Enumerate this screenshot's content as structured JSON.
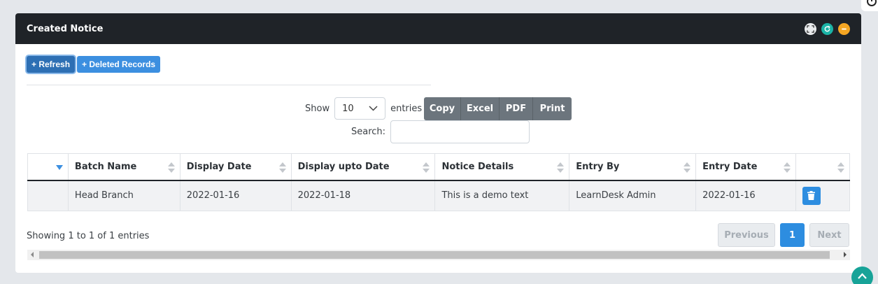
{
  "panel": {
    "title": "Created Notice",
    "tools": [
      "fullscreen-icon",
      "reload-icon",
      "minimize-icon"
    ]
  },
  "actions": {
    "refresh_label": "+ Refresh",
    "deleted_label": "+ Deleted Records"
  },
  "length": {
    "show_label": "Show",
    "value": "10",
    "entries_label": "entries"
  },
  "export": {
    "copy": "Copy",
    "excel": "Excel",
    "pdf": "PDF",
    "print": "Print"
  },
  "search": {
    "label": "Search:",
    "value": ""
  },
  "table": {
    "columns": [
      "",
      "Batch Name",
      "Display Date",
      "Display upto Date",
      "Notice Details",
      "Entry By",
      "Entry Date",
      ""
    ],
    "rows": [
      {
        "batch_name": "Head Branch",
        "display_date": "2022-01-16",
        "display_upto_date": "2022-01-18",
        "notice_details": "This is a demo text",
        "entry_by": "LearnDesk Admin",
        "entry_date": "2022-01-16",
        "action_icon": "trash-icon"
      }
    ]
  },
  "footer": {
    "info": "Showing 1 to 1 of 1 entries",
    "previous": "Previous",
    "current_page": "1",
    "next": "Next"
  },
  "colors": {
    "header_bg": "#1f2328",
    "primary": "#2d8de0",
    "export_btn": "#6c757d",
    "teal": "#1bb3a6",
    "orange": "#f5a623"
  }
}
